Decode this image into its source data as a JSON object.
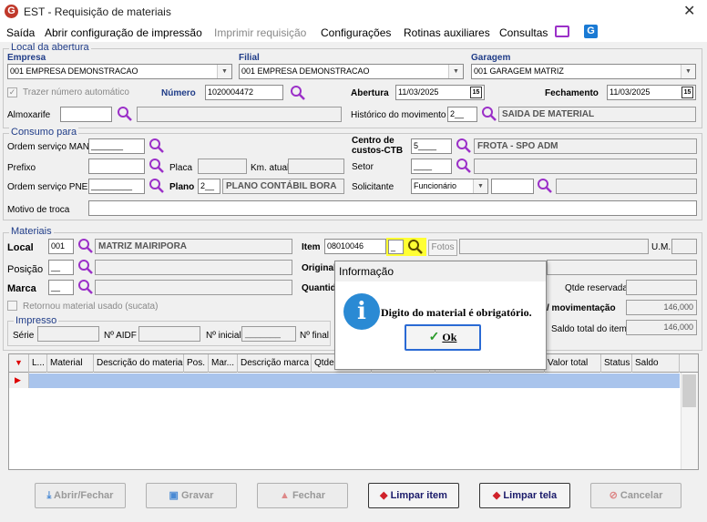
{
  "window": {
    "title": "EST - Requisição de materiais",
    "close": "✕"
  },
  "menu": [
    "Saída",
    "Abrir configuração de impressão",
    "Imprimir requisição",
    "Configurações",
    "Rotinas auxiliares",
    "Consultas"
  ],
  "local_abertura": {
    "group_label": "Local da abertura",
    "empresa_label": "Empresa",
    "empresa_value": "001 EMPRESA DEMONSTRACAO",
    "filial_label": "Filial",
    "filial_value": "001 EMPRESA DEMONSTRACAO",
    "garagem_label": "Garagem",
    "garagem_value": "001 GARAGEM MATRIZ",
    "trazer_label": "Trazer número automático",
    "numero_label": "Número",
    "numero_value": "1020004472",
    "abertura_label": "Abertura",
    "abertura_value": "11/03/2025",
    "fechamento_label": "Fechamento",
    "fechamento_value": "11/03/2025",
    "almoxarife_label": "Almoxarife",
    "historico_label": "Histórico do movimento",
    "historico_code": "2__",
    "historico_value": "SAIDA DE MATERIAL",
    "cal_icon": "15"
  },
  "consumo": {
    "group_label": "Consumo para",
    "os_man_label": "Ordem serviço MAN",
    "os_man_value": "_______",
    "centro_label_1": "Centro de",
    "centro_label_2": "custos-CTB",
    "centro_code": "5____",
    "centro_value": "FROTA - SPO ADM",
    "prefixo_label": "Prefixo",
    "placa_label": "Placa",
    "km_label": "Km. atual",
    "setor_label": "Setor",
    "setor_value": "____",
    "os_pne_label": "Ordem serviço PNE",
    "os_pne_value": "_________",
    "plano_label": "Plano",
    "plano_code": "2__",
    "plano_value": "PLANO CONTÁBIL BORA",
    "solicitante_label": "Solicitante",
    "solicitante_type": "Funcionário",
    "motivo_label": "Motivo de troca"
  },
  "materiais": {
    "group_label": "Materiais",
    "local_label": "Local",
    "local_code": "001",
    "local_value": "MATRIZ MAIRIPORA",
    "item_label": "Item",
    "item_value": "08010046",
    "digit_value": "_",
    "fotos_label": "Fotos",
    "um_label": "U.M.",
    "posicao_label": "Posição",
    "posicao_value": "__",
    "original_label": "Original",
    "marca_label": "Marca",
    "marca_value": "__",
    "quantidade_label": "Quantid",
    "qtde_reservada_label": "Qtde reservada",
    "movimentacao_label": "/ movimentação",
    "movimentacao_value": "146,000",
    "retornou_label": "Retornou material usado (sucata)",
    "saldo_label": "Saldo total do item",
    "saldo_value": "146,000"
  },
  "impresso": {
    "group_label": "Impresso",
    "serie_label": "Série",
    "aidf_label": "Nº AIDF",
    "inicial_label": "Nº inicial",
    "inicial_value": "_______",
    "final_label": "Nº final"
  },
  "grid": {
    "columns": [
      "L...",
      "Material",
      "Descrição do material",
      "Pos.",
      "Mar...",
      "Descrição marca",
      "Qtde.",
      "",
      "",
      "",
      "Valor total",
      "Status",
      "Saldo"
    ]
  },
  "buttons": {
    "abrir_fechar": "Abrir/Fechar",
    "gravar": "Gravar",
    "fechar": "Fechar",
    "limpar_item": "Limpar item",
    "limpar_tela": "Limpar tela",
    "cancelar": "Cancelar"
  },
  "dialog": {
    "title": "Informação",
    "message": "Digito do material é obrigatório.",
    "ok_label": "Ok",
    "info_glyph": "i"
  },
  "colors": {
    "accent": "#1f3c88",
    "highlight": "#ffff33",
    "grid_row": "#a9c4ec",
    "info_icon": "#2a8ad4"
  }
}
